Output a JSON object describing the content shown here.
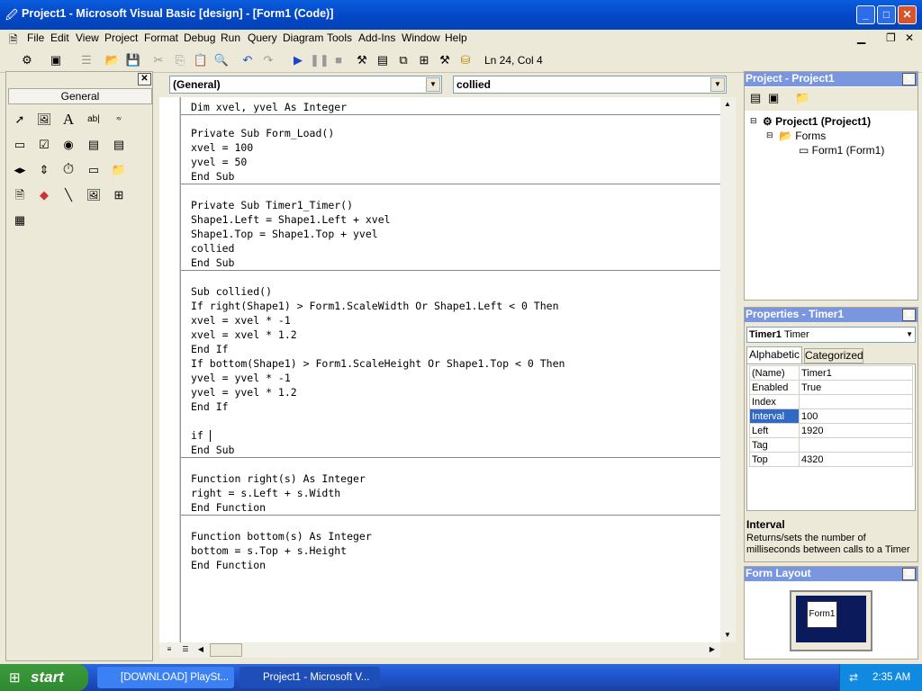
{
  "window": {
    "title": "Project1 - Microsoft Visual Basic [design] - [Form1 (Code)]"
  },
  "menu": [
    "File",
    "Edit",
    "View",
    "Project",
    "Format",
    "Debug",
    "Run",
    "Query",
    "Diagram",
    "Tools",
    "Add-Ins",
    "Window",
    "Help"
  ],
  "toolbar": {
    "cursor_pos": "Ln 24, Col 4"
  },
  "toolbox": {
    "tab": "General"
  },
  "code_window": {
    "object_combo": "(General)",
    "proc_combo": "collied",
    "procedures": [
      {
        "lines": [
          "Dim xvel, yvel As Integer"
        ]
      },
      {
        "lines": [
          "Private Sub Form_Load()",
          "xvel = 100",
          "yvel = 50",
          "End Sub"
        ]
      },
      {
        "lines": [
          "Private Sub Timer1_Timer()",
          "Shape1.Left = Shape1.Left + xvel",
          "Shape1.Top = Shape1.Top + yvel",
          "collied",
          "End Sub"
        ]
      },
      {
        "lines": [
          "Sub collied()",
          "If right(Shape1) > Form1.ScaleWidth Or Shape1.Left < 0 Then",
          "xvel = xvel * -1",
          "xvel = xvel * 1.2",
          "End If",
          "If bottom(Shape1) > Form1.ScaleHeight Or Shape1.Top < 0 Then",
          "yvel = yvel * -1",
          "yvel = yvel * 1.2",
          "End If",
          "",
          "if ",
          "End Sub"
        ]
      },
      {
        "lines": [
          "Function right(s) As Integer",
          "right = s.Left + s.Width",
          "End Function"
        ]
      },
      {
        "lines": [
          "Function bottom(s) As Integer",
          "bottom = s.Top + s.Height",
          "End Function"
        ]
      }
    ]
  },
  "project_panel": {
    "title": "Project - Project1",
    "root": "Project1 (Project1)",
    "folder": "Forms",
    "item": "Form1 (Form1)"
  },
  "properties_panel": {
    "title": "Properties - Timer1",
    "object_name": "Timer1",
    "object_type": "Timer",
    "tabs": [
      "Alphabetic",
      "Categorized"
    ],
    "rows": [
      {
        "name": "(Name)",
        "value": "Timer1"
      },
      {
        "name": "Enabled",
        "value": "True"
      },
      {
        "name": "Index",
        "value": ""
      },
      {
        "name": "Interval",
        "value": "100"
      },
      {
        "name": "Left",
        "value": "1920"
      },
      {
        "name": "Tag",
        "value": ""
      },
      {
        "name": "Top",
        "value": "4320"
      }
    ],
    "desc_title": "Interval",
    "desc_text": "Returns/sets the number of milliseconds between calls to a Timer"
  },
  "form_layout": {
    "title": "Form Layout",
    "form_label": "Form1"
  },
  "taskbar": {
    "start": "start",
    "tasks": [
      "[DOWNLOAD] PlaySt...",
      "Project1 - Microsoft V..."
    ],
    "clock": "2:35 AM"
  }
}
